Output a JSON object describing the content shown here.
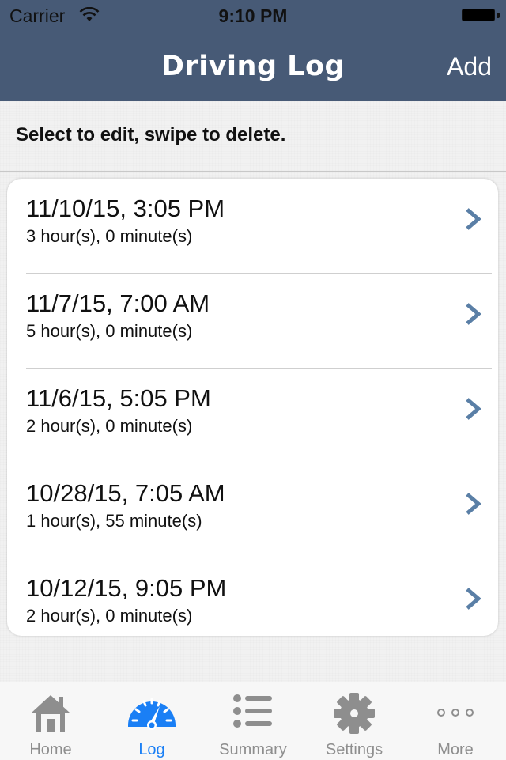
{
  "status_bar": {
    "carrier": "Carrier",
    "time": "9:10 PM"
  },
  "nav": {
    "title": "Driving Log",
    "add_label": "Add"
  },
  "instruction": "Select to edit, swipe to delete.",
  "entries": [
    {
      "date": "11/10/15, 3:05 PM",
      "duration": "3 hour(s), 0 minute(s)"
    },
    {
      "date": "11/7/15, 7:00 AM",
      "duration": "5 hour(s), 0 minute(s)"
    },
    {
      "date": "11/6/15, 5:05 PM",
      "duration": "2 hour(s), 0 minute(s)"
    },
    {
      "date": "10/28/15, 7:05 AM",
      "duration": "1 hour(s), 55 minute(s)"
    },
    {
      "date": "10/12/15, 9:05 PM",
      "duration": "2 hour(s), 0 minute(s)"
    }
  ],
  "tabs": [
    {
      "label": "Home",
      "icon": "house-icon"
    },
    {
      "label": "Log",
      "icon": "speedometer-icon",
      "active": true
    },
    {
      "label": "Summary",
      "icon": "list-icon"
    },
    {
      "label": "Settings",
      "icon": "gear-icon"
    },
    {
      "label": "More",
      "icon": "more-dots-icon"
    }
  ],
  "colors": {
    "nav_bar": "#475a76",
    "chevron": "#5a7fa6",
    "tab_active": "#1a7ff5",
    "tab_inactive": "#8e8e8e"
  }
}
